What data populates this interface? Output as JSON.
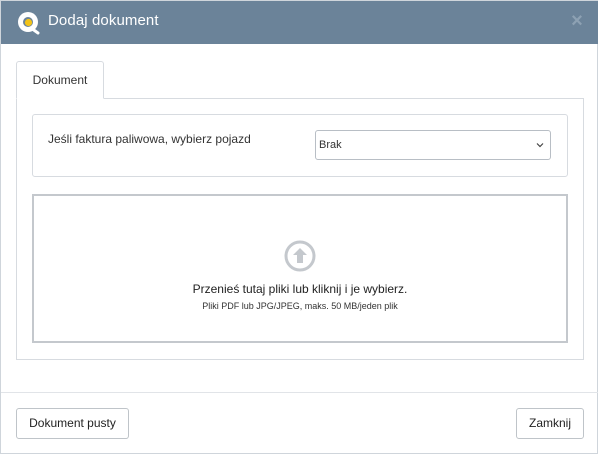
{
  "dialog": {
    "title": "Dodaj dokument",
    "close_symbol": "×"
  },
  "tabs": [
    {
      "label": "Dokument",
      "active": true
    }
  ],
  "vehicle": {
    "label": "Jeśli faktura paliwowa, wybierz pojazd",
    "selected": "Brak"
  },
  "dropzone": {
    "main_text": "Przenieś tutaj pliki lub kliknij i je wybierz.",
    "sub_text": "Pliki PDF lub JPG/JPEG, maks. 50 MB/jeden plik",
    "icon": "upload-arrow-circle-icon"
  },
  "footer": {
    "empty_doc_label": "Dokument pusty",
    "close_label": "Zamknij"
  },
  "colors": {
    "titlebar": "#6b8399",
    "logo_accent": "#f2c318",
    "border": "#d7dbe0"
  }
}
